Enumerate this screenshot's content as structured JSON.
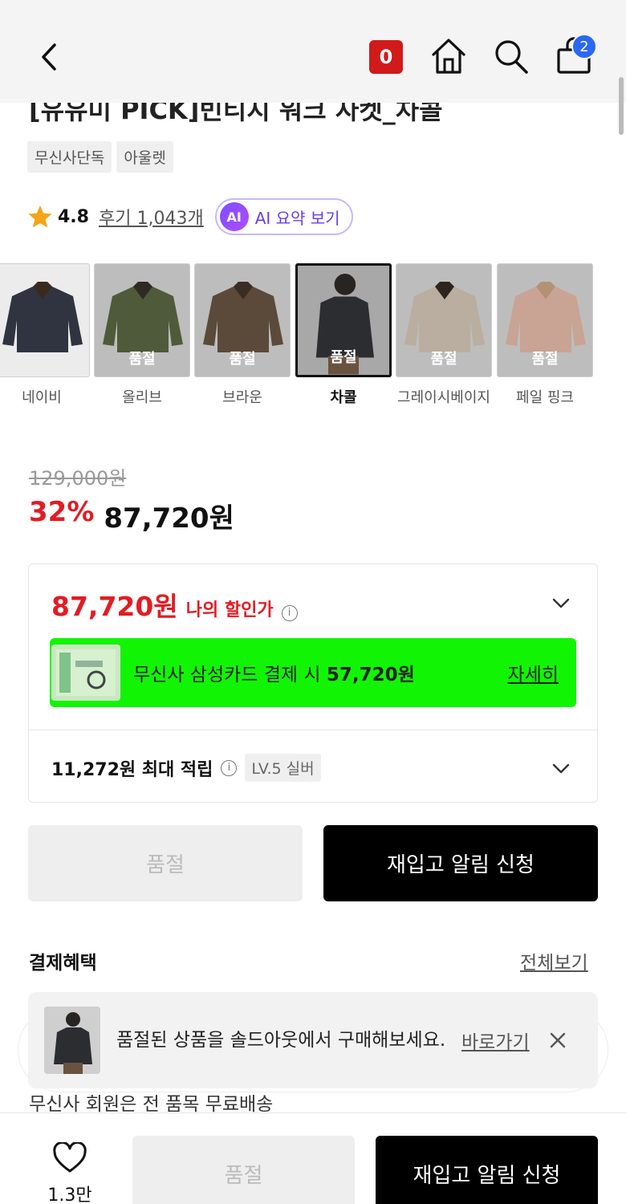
{
  "header": {
    "musinsa_badge": "0",
    "cart_count": "2"
  },
  "product": {
    "title_partial": "[유유미 PICK]빈티지 워크 자켓_차콜",
    "tags": [
      "무신사단독",
      "아울렛"
    ],
    "rating": "4.8",
    "review_label": "후기 1,043개",
    "ai_badge": "AI",
    "ai_summary_label": "AI 요약 보기"
  },
  "colors": {
    "soldout_label": "품절",
    "options": [
      {
        "label": "네이비",
        "soldout": false,
        "selected": false,
        "swatch": "#2f3440",
        "collar": "#3a2a1e"
      },
      {
        "label": "올리브",
        "soldout": true,
        "selected": false,
        "swatch": "#4f5a3a",
        "collar": "#2f2a22"
      },
      {
        "label": "브라운",
        "soldout": true,
        "selected": false,
        "swatch": "#5b4a3a",
        "collar": "#3a2e24"
      },
      {
        "label": "차콜",
        "soldout": true,
        "selected": true,
        "swatch": "#2b2d31",
        "collar": "#1f1f1f"
      },
      {
        "label": "그레이시베이지",
        "soldout": true,
        "selected": false,
        "swatch": "#b9aea0",
        "collar": "#2d241d"
      },
      {
        "label": "페일 핑크",
        "soldout": true,
        "selected": false,
        "swatch": "#c9a394",
        "collar": "#b39274"
      }
    ]
  },
  "pricing": {
    "original": "129,000원",
    "discount_rate": "32%",
    "sale_price": "87,720원"
  },
  "my_discount": {
    "amount": "87,720원",
    "label": "나의 할인가",
    "info_icon": "i",
    "card_text_prefix": "무신사 삼성카드 결제 시 ",
    "card_text_amount": "57,720원",
    "card_more": "자세히",
    "points_text": "11,272원 최대 적립",
    "level": "LV.5 실버"
  },
  "actions": {
    "soldout": "품절",
    "restock": "재입고 알림 신청"
  },
  "benefits": {
    "title": "결제혜택",
    "view_all": "전체보기",
    "shipping_note": "무신사 회원은 전 품목 무료배송"
  },
  "toast": {
    "message": "품절된 상품을 솔드아웃에서 구매해보세요.",
    "link": "바로가기"
  },
  "bottom_bar": {
    "like_count": "1.3만",
    "soldout": "품절",
    "restock": "재입고 알림 신청"
  },
  "colors_theme": {
    "accent_red": "#e21c23",
    "card_green": "#11f505",
    "ai_purple": "#6a3de8",
    "cart_blue": "#2a67f5"
  }
}
